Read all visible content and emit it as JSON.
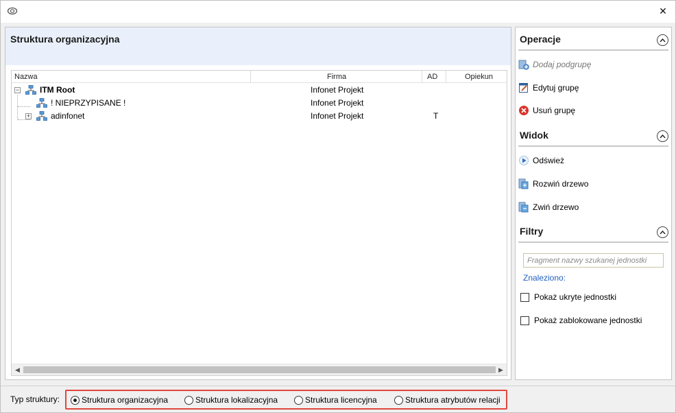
{
  "window": {
    "close_glyph": "✕"
  },
  "main": {
    "title": "Struktura organizacyjna",
    "columns": {
      "nazwa": "Nazwa",
      "firma": "Firma",
      "ad": "AD",
      "opiekun": "Opiekun"
    },
    "rows": [
      {
        "name": "ITM Root",
        "firma": "Infonet Projekt",
        "ad": "",
        "opiekun": "",
        "expander": "⊟"
      },
      {
        "name": "! NIEPRZYPISANE !",
        "firma": "Infonet Projekt",
        "ad": "",
        "opiekun": "",
        "expander": ""
      },
      {
        "name": "adinfonet",
        "firma": "Infonet Projekt",
        "ad": "T",
        "opiekun": "",
        "expander": "+"
      }
    ],
    "scroll_left": "◀",
    "scroll_right": "▶"
  },
  "side": {
    "operacje": {
      "title": "Operacje",
      "items": [
        "Dodaj podgrupę",
        "Edytuj grupę",
        "Usuń grupę"
      ]
    },
    "widok": {
      "title": "Widok",
      "items": [
        "Odśwież",
        "Rozwiń drzewo",
        "Zwiń drzewo"
      ]
    },
    "filtry": {
      "title": "Filtry",
      "search_placeholder": "Fragment nazwy szukanej jednostki",
      "search_value": "",
      "found_label": "Znaleziono:",
      "checkboxes": [
        "Pokaż ukryte jednostki",
        "Pokaż zablokowane jednostki"
      ]
    },
    "collapse_glyph": "^"
  },
  "bottom": {
    "type_label": "Typ struktury:",
    "radios": [
      "Struktura organizacyjna",
      "Struktura lokalizacyjna",
      "Struktura licencyjna",
      "Struktura atrybutów relacji"
    ],
    "selected": "Struktura organizacyjna"
  }
}
